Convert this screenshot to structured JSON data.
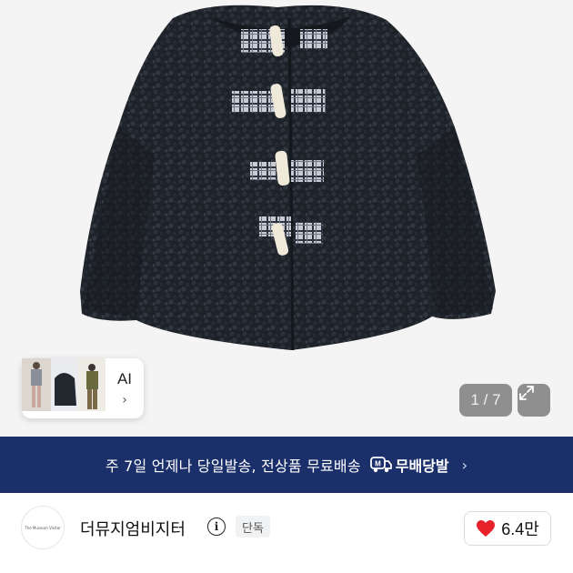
{
  "gallery": {
    "counter": "1 / 7",
    "expand_icon": "expand-icon"
  },
  "ai_card": {
    "label": "AI",
    "chevron": "›"
  },
  "banner": {
    "text": "주 7일 언제나 당일발송, 전상품 무료배송",
    "brand": "무배당발",
    "chevron": "›",
    "background": "#1b2f6b"
  },
  "store": {
    "logo_text": "The Museum Visitor",
    "name": "더뮤지엄비지터",
    "info_icon": "info-icon",
    "badge": "단독",
    "like_count": "6.4만",
    "like_color": "#e8222b"
  }
}
